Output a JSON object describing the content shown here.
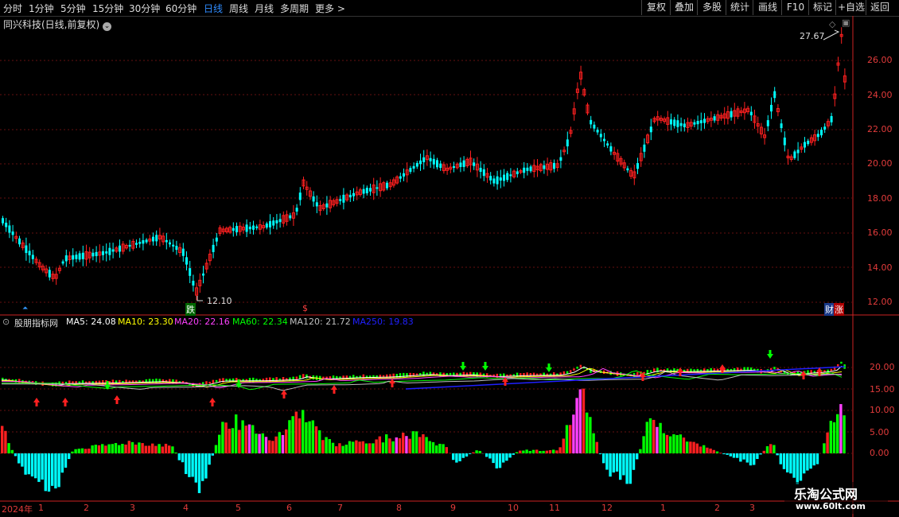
{
  "toolbar": {
    "periods": [
      "分时",
      "1分钟",
      "5分钟",
      "15分钟",
      "30分钟",
      "60分钟",
      "日线",
      "周线",
      "月线",
      "多周期",
      "更多"
    ],
    "active_period": "日线",
    "right_buttons": [
      "复权",
      "叠加",
      "多股",
      "统计",
      "画线",
      "F10",
      "标记",
      "+自选",
      "返回"
    ]
  },
  "price_panel": {
    "title": "同兴科技(日线,前复权)",
    "high_label": "27.67",
    "low_label": "12.10",
    "axis_ticks": [
      "26.00",
      "24.00",
      "22.00",
      "20.00",
      "18.00",
      "16.00",
      "14.00",
      "12.00"
    ],
    "markers": {
      "drop": "跌",
      "finance": "财",
      "rise": "涨",
      "dollar": "$"
    }
  },
  "indicator_panel": {
    "name": "股朋指标网",
    "ma_legends": [
      {
        "text": "MA5: 24.08",
        "color": "#ffffff"
      },
      {
        "text": "MA10: 23.30",
        "color": "#ffff00"
      },
      {
        "text": "MA20: 22.16",
        "color": "#ff40ff"
      },
      {
        "text": "MA60: 22.34",
        "color": "#00ff00"
      },
      {
        "text": "MA120: 21.72",
        "color": "#c0c0c0"
      },
      {
        "text": "MA250: 19.83",
        "color": "#2020ff"
      }
    ],
    "axis_ticks": [
      "20.00",
      "15.00",
      "10.00",
      "5.00",
      "0.00"
    ]
  },
  "histogram_axis_ticks": [
    "10.00",
    "5.00",
    "0.00"
  ],
  "time_axis": {
    "year": "2024年",
    "months": [
      "1",
      "2",
      "3",
      "4",
      "5",
      "6",
      "7",
      "8",
      "9",
      "10",
      "11",
      "12",
      "1",
      "2",
      "3"
    ]
  },
  "watermark": {
    "title": "乐淘公式网",
    "url": "www.60lt.com"
  },
  "colors": {
    "up": "#ff2020",
    "down": "#00ff00",
    "neg": "#00ffff",
    "axis": "#cc2222",
    "grid": "#661111"
  }
}
